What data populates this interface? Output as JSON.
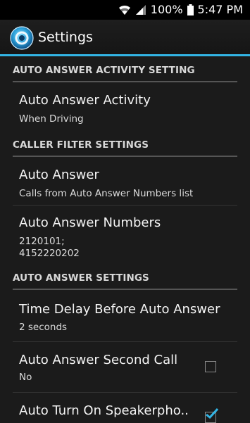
{
  "status_bar": {
    "battery": "100%",
    "time": "5:47 PM",
    "icons": [
      "wifi-icon",
      "signal-icon",
      "battery-icon"
    ]
  },
  "action_bar": {
    "title": "Settings",
    "accent_color": "#33b5e5"
  },
  "sections": [
    {
      "header": "AUTO ANSWER ACTIVITY SETTING",
      "items": [
        {
          "title": "Auto Answer Activity",
          "summary": "When Driving"
        }
      ]
    },
    {
      "header": "CALLER FILTER SETTINGS",
      "items": [
        {
          "title": "Auto Answer",
          "summary": "Calls from Auto Answer Numbers list"
        },
        {
          "title": "Auto Answer Numbers",
          "summary_lines": [
            "2120101;",
            "4152220202"
          ]
        }
      ]
    },
    {
      "header": "AUTO ANSWER SETTINGS",
      "items": [
        {
          "title": "Time Delay Before Auto Answer",
          "summary": "2 seconds"
        },
        {
          "title": "Auto Answer Second Call",
          "summary": "No",
          "checked": false
        },
        {
          "title": "Auto Turn On Speakerpho..",
          "checked": true
        }
      ]
    }
  ]
}
